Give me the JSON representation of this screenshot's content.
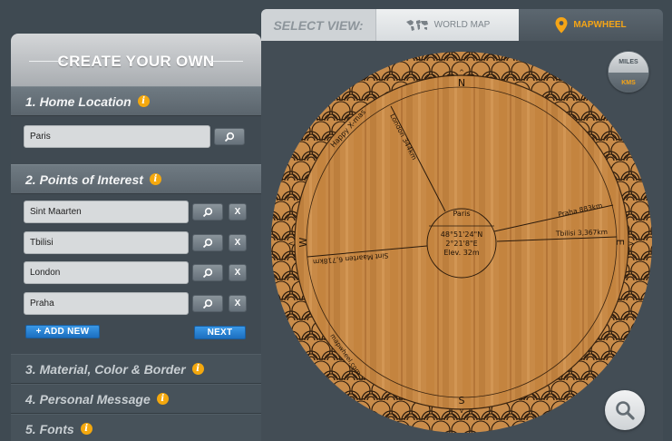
{
  "panel": {
    "title": "CREATE YOUR OWN",
    "sections": [
      {
        "title": "1. Home Location"
      },
      {
        "title": "2. Points of Interest"
      },
      {
        "title": "3. Material, Color & Border"
      },
      {
        "title": "4. Personal Message"
      },
      {
        "title": "5. Fonts"
      }
    ],
    "info_glyph": "i",
    "home_location": {
      "value": "Paris"
    },
    "points": [
      {
        "value": "Sint Maarten"
      },
      {
        "value": "Tbilisi"
      },
      {
        "value": "London"
      },
      {
        "value": "Praha"
      }
    ],
    "remove_label": "X",
    "add_new_label": "+ ADD NEW",
    "next_label": "NEXT"
  },
  "viewbar": {
    "select_label": "SELECT VIEW:",
    "world_map_label": "WORLD MAP",
    "mapwheel_label": "MAPWHEEL"
  },
  "units": {
    "miles_label": "MILES",
    "kms_label": "KMS",
    "selected": "KMS"
  },
  "wheel": {
    "compass": {
      "n": "N",
      "s": "S",
      "e": "E",
      "w": "W"
    },
    "center": {
      "city": "Paris",
      "lat": "48°51'24\"N",
      "lon": "2°21'8\"E",
      "elev": "Elev. 32m"
    },
    "labels": {
      "london": "London 344km",
      "praha": "Praha 883km",
      "tbilisi": "Tbilisi 3,367km",
      "sint_maarten": "Sint Maarten 6,718km",
      "message": "Happy X-mas",
      "website": "mapwheel.com"
    }
  },
  "colors": {
    "accent": "#f6a516",
    "button_blue": "#1f74c4",
    "wood": "#c78a47"
  }
}
